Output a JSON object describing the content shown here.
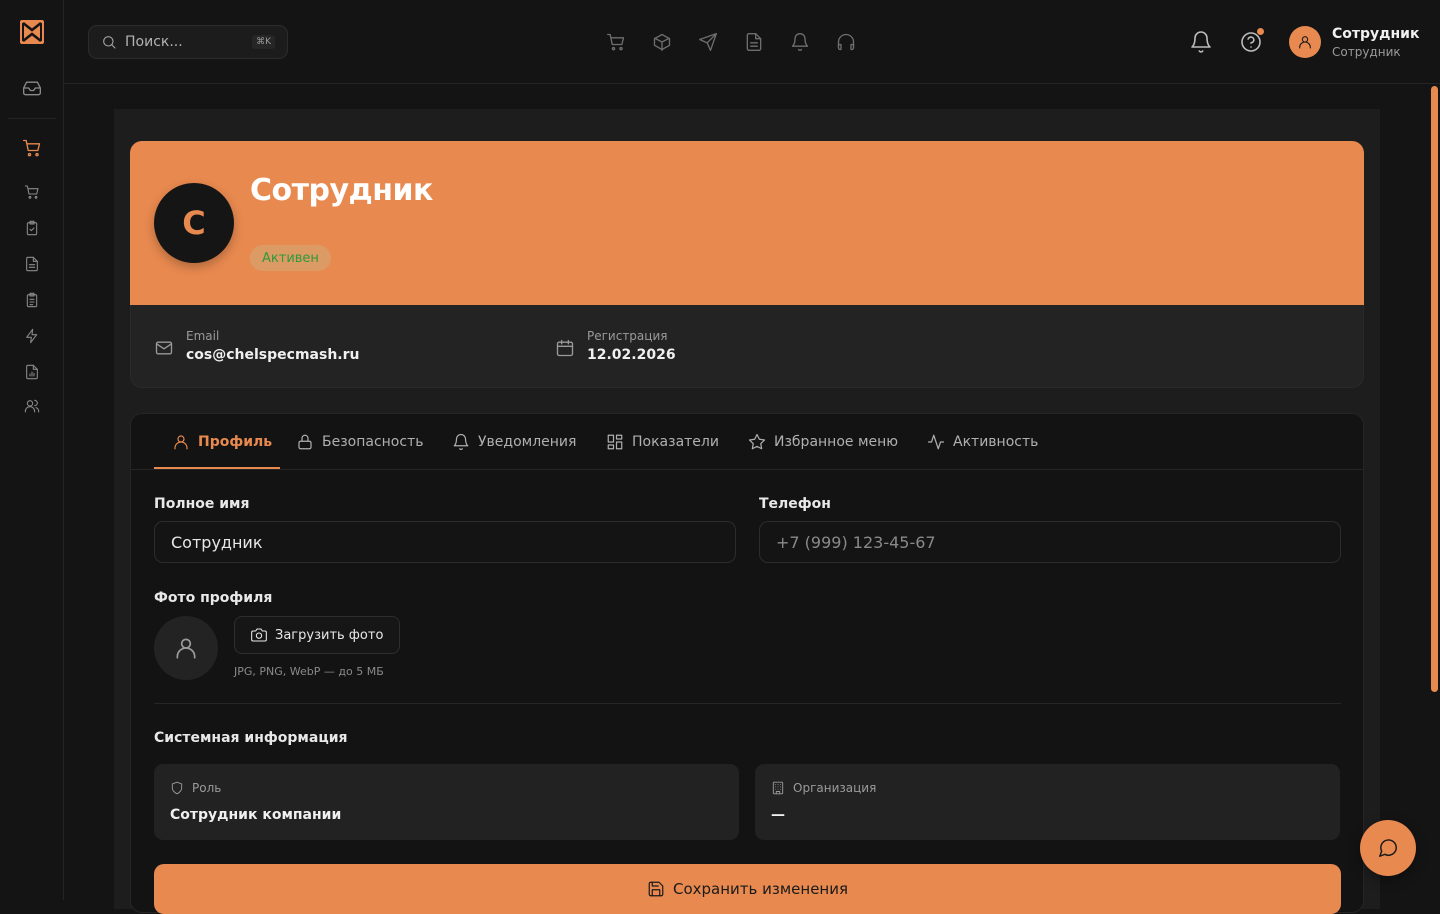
{
  "header": {
    "search_placeholder": "Поиск...",
    "search_shortcut": "⌘K",
    "user_name": "Сотрудник",
    "user_role": "Сотрудник"
  },
  "profile": {
    "avatar_initial": "С",
    "name": "Сотрудник",
    "status": "Активен",
    "email_label": "Email",
    "email_value": "cos@chelspecmash.ru",
    "reg_label": "Регистрация",
    "reg_value": "12.02.2026"
  },
  "tabs": [
    {
      "label": "Профиль",
      "icon": "user-icon",
      "active": true
    },
    {
      "label": "Безопасность",
      "icon": "lock-icon",
      "active": false
    },
    {
      "label": "Уведомления",
      "icon": "bell-icon",
      "active": false
    },
    {
      "label": "Показатели",
      "icon": "grid-icon",
      "active": false
    },
    {
      "label": "Избранное меню",
      "icon": "star-icon",
      "active": false
    },
    {
      "label": "Активность",
      "icon": "activity-icon",
      "active": false
    }
  ],
  "form": {
    "full_name_label": "Полное имя",
    "full_name_value": "Сотрудник",
    "phone_label": "Телефон",
    "phone_placeholder": "+7 (999) 123-45-67",
    "photo_label": "Фото профиля",
    "upload_label": "Загрузить фото",
    "photo_hint": "JPG, PNG, WebP — до 5 МБ",
    "system_title": "Системная информация",
    "role_label": "Роль",
    "role_value": "Сотрудник компании",
    "org_label": "Организация",
    "org_value": "—",
    "save_label": "Сохранить изменения"
  },
  "colors": {
    "accent": "#e8894f",
    "background": "#141414",
    "status_green": "#2e9a3a"
  }
}
